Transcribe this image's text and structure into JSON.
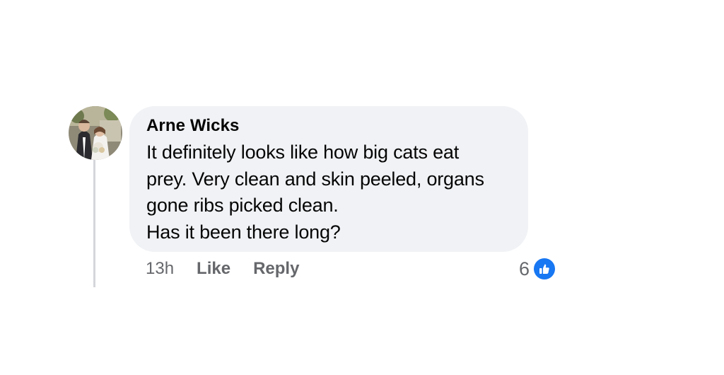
{
  "comment": {
    "author": "Arne Wicks",
    "text": "It definitely looks like how big cats eat\nprey. Very clean and skin peeled, organs\ngone ribs picked clean.\nHas it been there long?",
    "avatar_icon": "profile-photo"
  },
  "actions": {
    "time": "13h",
    "like_label": "Like",
    "reply_label": "Reply"
  },
  "reactions": {
    "count": "6",
    "icon": "thumbs-up-icon",
    "color": "#1877f2"
  },
  "colors": {
    "bubble_bg": "#f0f2f5",
    "secondary_text": "#65676b",
    "thread_line": "#d4d6da"
  }
}
